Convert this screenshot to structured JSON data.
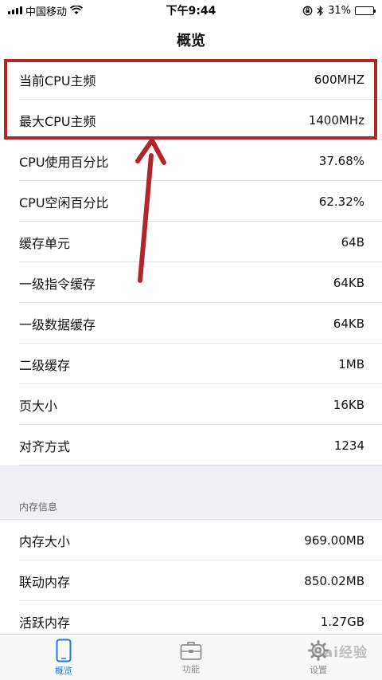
{
  "status_bar": {
    "carrier": "中国移动",
    "time": "下午9:44",
    "battery": "31%",
    "battery_level": 0.31
  },
  "nav": {
    "title": "概览"
  },
  "cpu_rows": [
    {
      "label": "当前CPU主频",
      "value": "600MHZ"
    },
    {
      "label": "最大CPU主频",
      "value": "1400MHz"
    },
    {
      "label": "CPU使用百分比",
      "value": "37.68%"
    },
    {
      "label": "CPU空闲百分比",
      "value": "62.32%"
    },
    {
      "label": "缓存单元",
      "value": "64B"
    },
    {
      "label": "一级指令缓存",
      "value": "64KB"
    },
    {
      "label": "一级数据缓存",
      "value": "64KB"
    },
    {
      "label": "二级缓存",
      "value": "1MB"
    },
    {
      "label": "页大小",
      "value": "16KB"
    },
    {
      "label": "对齐方式",
      "value": "1234"
    }
  ],
  "memory_section": {
    "header": "内存信息",
    "rows": [
      {
        "label": "内存大小",
        "value": "969.00MB"
      },
      {
        "label": "联动内存",
        "value": "850.02MB"
      },
      {
        "label": "活跃内存",
        "value": "1.27GB"
      }
    ]
  },
  "tabs": [
    {
      "label": "概览",
      "icon": "phone-icon",
      "active": true
    },
    {
      "label": "功能",
      "icon": "briefcase-icon",
      "active": false
    },
    {
      "label": "设置",
      "icon": "gear-icon",
      "active": false
    }
  ],
  "watermark": "Bai经验",
  "colors": {
    "highlight": "#b0262a",
    "active_tab": "#1f7ae0",
    "inactive_tab": "#8e8e93"
  }
}
